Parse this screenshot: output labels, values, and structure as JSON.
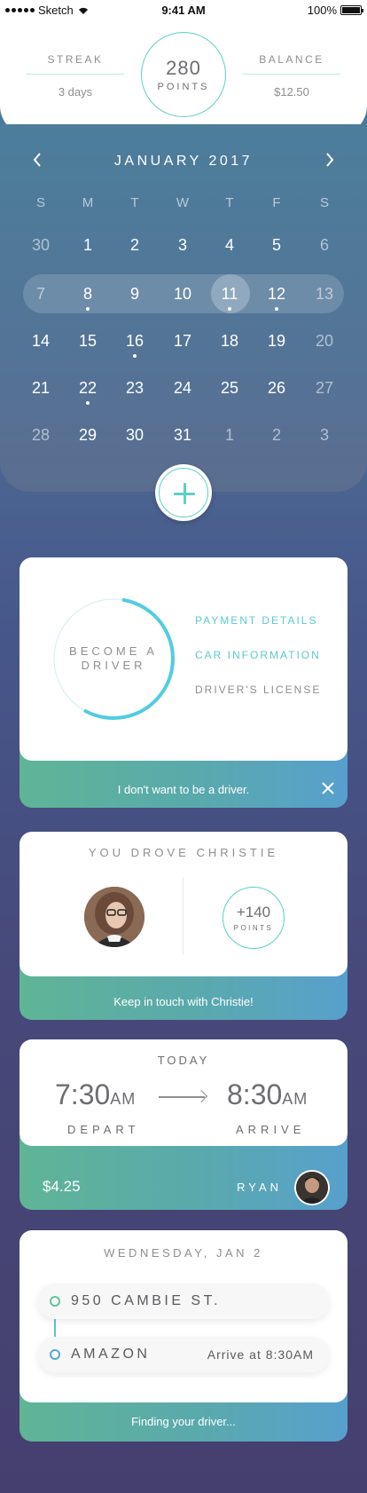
{
  "status_bar": {
    "carrier": "Sketch",
    "time": "9:41 AM",
    "battery": "100%"
  },
  "header": {
    "streak_label": "STREAK",
    "streak_value": "3 days",
    "points_value": "280",
    "points_label": "POINTS",
    "balance_label": "BALANCE",
    "balance_value": "$12.50"
  },
  "calendar": {
    "title": "JANUARY 2017",
    "prev_icon": "chevron-left-icon",
    "next_icon": "chevron-right-icon",
    "weekdays": [
      "S",
      "M",
      "T",
      "W",
      "T",
      "F",
      "S"
    ],
    "weeks": [
      [
        "30",
        "1",
        "2",
        "3",
        "4",
        "5",
        "6"
      ],
      [
        "7",
        "8",
        "9",
        "10",
        "11",
        "12",
        "13"
      ],
      [
        "14",
        "15",
        "16",
        "17",
        "18",
        "19",
        "20"
      ],
      [
        "21",
        "22",
        "23",
        "24",
        "25",
        "26",
        "27"
      ],
      [
        "28",
        "29",
        "30",
        "31",
        "1",
        "2",
        "3"
      ]
    ],
    "selected_day": "11"
  },
  "add_button_icon": "plus-icon",
  "driver_card": {
    "label_line1": "BECOME A",
    "label_line2": "DRIVER",
    "progress": 0.55,
    "links": [
      "PAYMENT DETAILS",
      "CAR INFORMATION",
      "DRIVER'S LICENSE"
    ],
    "decline_text": "I don't want to be a driver.",
    "close_icon": "close-icon"
  },
  "drove_card": {
    "title": "YOU DROVE CHRISTIE",
    "points": "+140",
    "points_label": "POINTS",
    "footer": "Keep in touch with Christie!"
  },
  "trip_card": {
    "label": "TODAY",
    "depart_time": "7:30",
    "depart_suffix": "AM",
    "depart_label": "DEPART",
    "arrive_time": "8:30",
    "arrive_suffix": "AM",
    "arrive_label": "ARRIVE",
    "price": "$4.25",
    "driver": "RYAN"
  },
  "route_card": {
    "date": "WEDNESDAY, JAN 2",
    "from": "950 CAMBIE ST.",
    "to": "AMAZON",
    "eta": "Arrive at 8:30AM",
    "footer": "Finding your driver..."
  },
  "colors": {
    "accent": "#5cd0c4",
    "link": "#5cc8d4",
    "green": "#5fb596",
    "blue": "#58a0cd"
  }
}
